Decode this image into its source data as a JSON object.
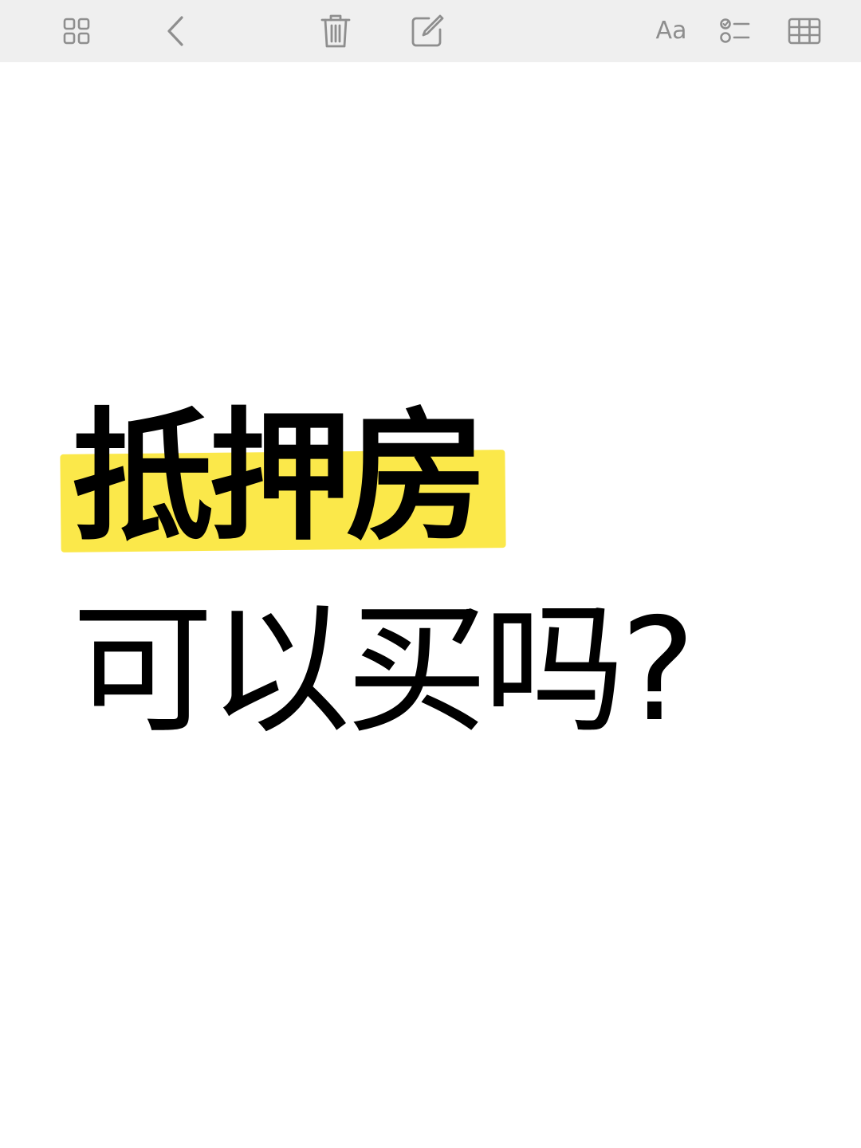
{
  "toolbar": {
    "icons": {
      "grid": "grid-icon",
      "back": "chevron-left-icon",
      "trash": "trash-icon",
      "compose": "compose-icon",
      "format": "text-format-icon",
      "checklist": "checklist-icon",
      "table": "table-icon"
    },
    "format_label": "Aa",
    "icon_color": "#8e8e8e",
    "background": "#efefef"
  },
  "note": {
    "title_highlighted": "抵押房",
    "title_rest": "可以买吗?",
    "highlight_color": "#fbe84a",
    "text_color": "#000000"
  }
}
